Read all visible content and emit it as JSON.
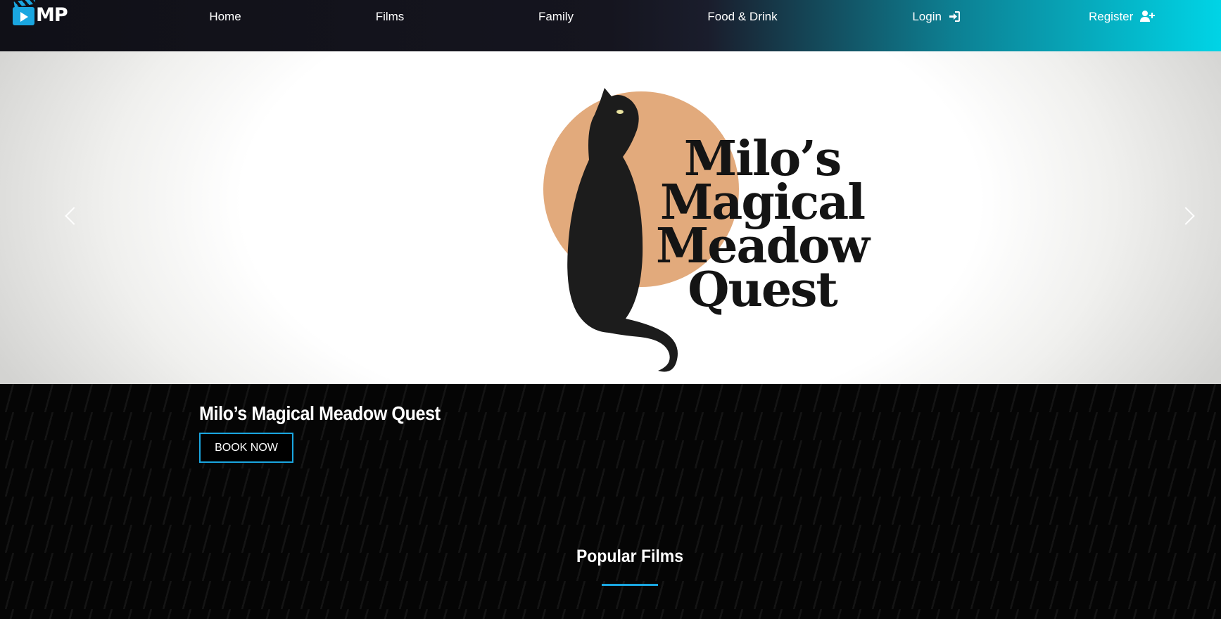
{
  "brand": {
    "logo_text": "MP"
  },
  "nav": {
    "home": "Home",
    "films": "Films",
    "family": "Family",
    "food_drink": "Food & Drink",
    "login": "Login",
    "register": "Register",
    "login_icon": "sign-in-icon",
    "register_icon": "user-plus-icon"
  },
  "hero": {
    "art_title_lines": [
      "Milo’s",
      "Magical",
      "Meadow",
      "Quest"
    ],
    "caption_title": "Milo’s Magical Meadow Quest",
    "cta_label": "BOOK NOW",
    "prev_icon": "chevron-left-icon",
    "next_icon": "chevron-right-icon"
  },
  "section": {
    "title": "Popular Films"
  },
  "colors": {
    "accent": "#1aa6e0",
    "nav_gradient_end": "#00d4e6",
    "sun": "#e2aa7c"
  }
}
